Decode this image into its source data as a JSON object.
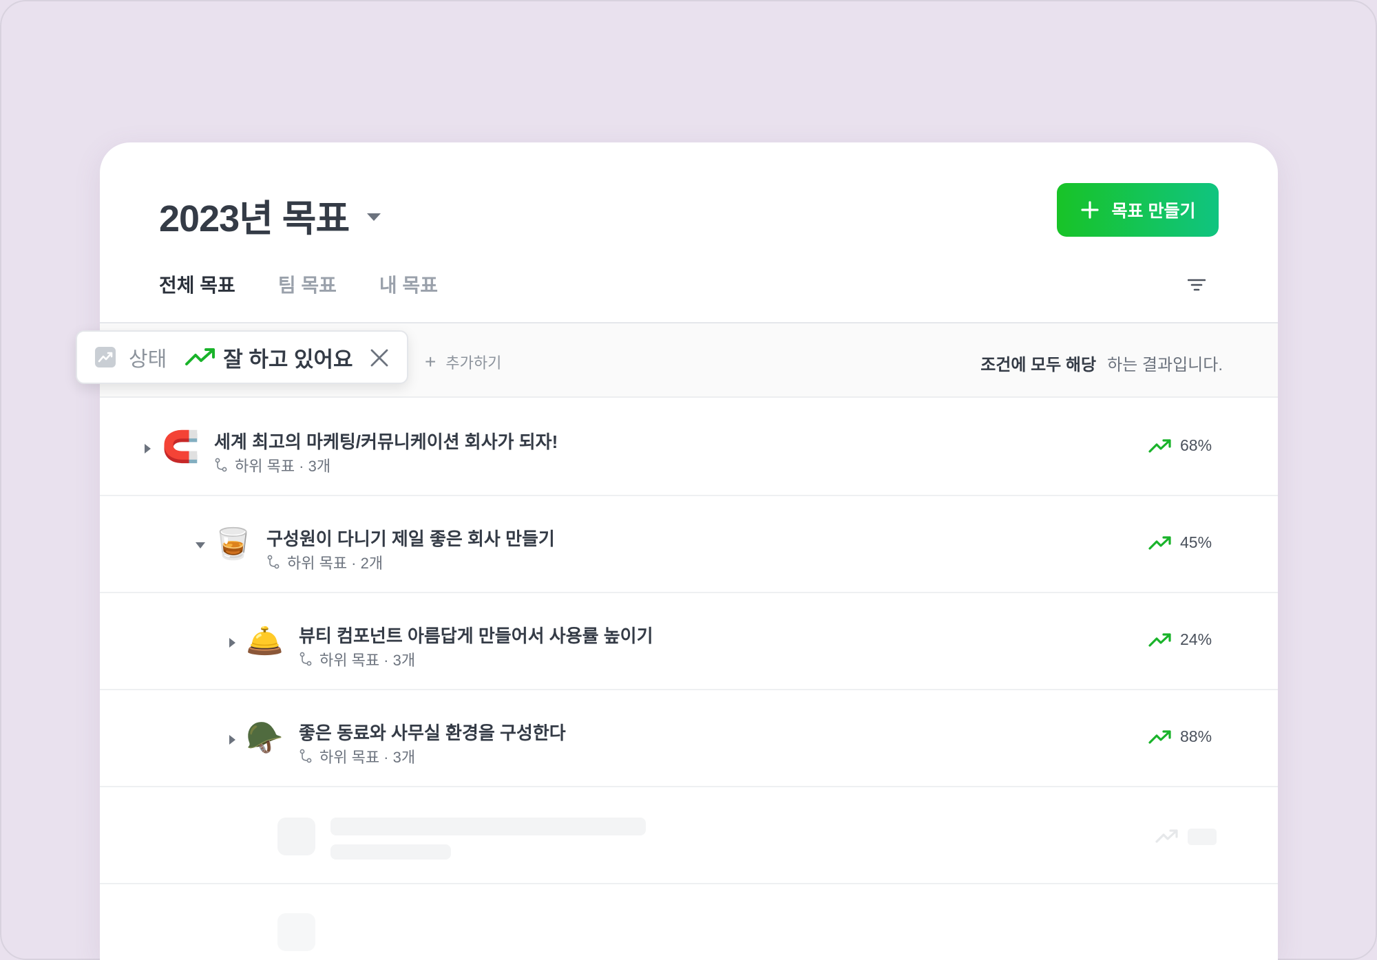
{
  "header": {
    "title": "2023년 목표",
    "create_button": "목표 만들기"
  },
  "tabs": [
    {
      "label": "전체 목표",
      "active": true
    },
    {
      "label": "팀 목표",
      "active": false
    },
    {
      "label": "내 목표",
      "active": false
    }
  ],
  "filter": {
    "chip_label": "상태",
    "chip_value": "잘 하고 있어요",
    "add_label": "추가하기",
    "result_bold": "조건에 모두 해당",
    "result_rest": "하는 결과입니다."
  },
  "goals": [
    {
      "title": "세계 최고의 마케팅/커뮤니케이션 회사가 되자!",
      "sub": "하위 목표 · 3개",
      "progress": "68%",
      "emoji": "🧲",
      "expanded": false
    },
    {
      "title": "구성원이 다니기 제일 좋은 회사 만들기",
      "sub": "하위 목표 · 2개",
      "progress": "45%",
      "emoji": "🥃",
      "expanded": true
    },
    {
      "title": "뷰티 컴포넌트 아름답게 만들어서 사용률 높이기",
      "sub": "하위 목표 · 3개",
      "progress": "24%",
      "emoji": "🛎️",
      "expanded": false
    },
    {
      "title": "좋은 동료와 사무실 환경을 구성한다",
      "sub": "하위 목표 · 3개",
      "progress": "88%",
      "emoji": "🪖",
      "expanded": false
    }
  ],
  "colors": {
    "accent_green": "#18c327",
    "accent_teal": "#10c480",
    "trend_green": "#19b32a",
    "background": "#e9e1ee"
  }
}
